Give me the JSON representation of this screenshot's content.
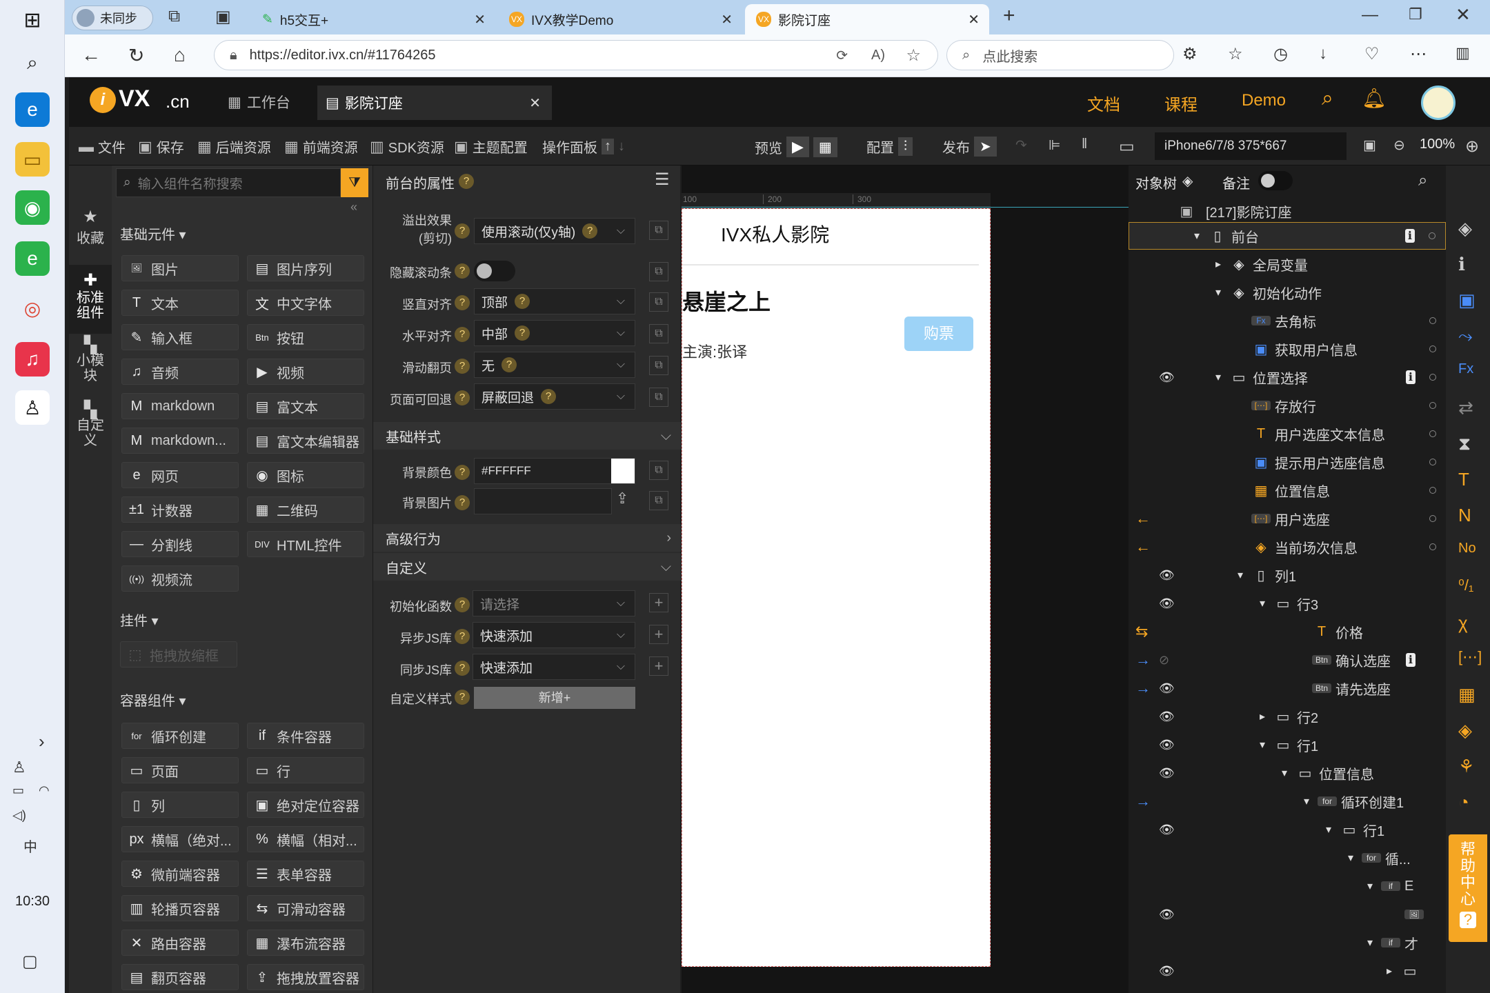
{
  "taskbar": {
    "time": "10:30"
  },
  "browser": {
    "profile": "未同步",
    "tabs": [
      {
        "label": "h5交互+"
      },
      {
        "label": "IVX教学Demo"
      },
      {
        "label": "影院订座"
      }
    ],
    "url": "https://editor.ivx.cn/#11764265",
    "search_placeholder": "点此搜索"
  },
  "app": {
    "logo": "VX",
    "logo_suffix": ".cn",
    "tabs": [
      {
        "label": "工作台"
      },
      {
        "label": "影院订座"
      }
    ],
    "nav": [
      {
        "label": "文档"
      },
      {
        "label": "课程"
      },
      {
        "label": "Demo"
      }
    ]
  },
  "toolbar": {
    "items": [
      {
        "label": "文件"
      },
      {
        "label": "保存"
      },
      {
        "label": "后端资源"
      },
      {
        "label": "前端资源"
      },
      {
        "label": "SDK资源"
      },
      {
        "label": "主题配置"
      },
      {
        "label": "操作面板"
      }
    ],
    "preview": "预览",
    "config": "配置",
    "publish": "发布",
    "device": "iPhone6/7/8 375*667",
    "zoom": "100%"
  },
  "leftside": [
    {
      "label": "收藏"
    },
    {
      "label": "标准组件"
    },
    {
      "label": "小模块"
    },
    {
      "label": "自定义"
    }
  ],
  "leftpanel": {
    "search_placeholder": "输入组件名称搜索",
    "section_basic": "基础元件",
    "basic": [
      "图片",
      "图片序列",
      "文本",
      "中文字体",
      "输入框",
      "按钮",
      "音频",
      "视频",
      "markdown",
      "富文本",
      "markdown...",
      "富文本编辑器",
      "网页",
      "图标",
      "计数器",
      "二维码",
      "分割线",
      "HTML控件",
      "视频流"
    ],
    "section_plugin": "挂件",
    "plugin": [
      "拖拽放缩框"
    ],
    "section_container": "容器组件",
    "container": [
      "循环创建",
      "条件容器",
      "页面",
      "行",
      "列",
      "绝对定位容器",
      "横幅（绝对...",
      "横幅（相对...",
      "微前端容器",
      "表单容器",
      "轮播页容器",
      "可滑动容器",
      "路由容器",
      "瀑布流容器",
      "翻页容器",
      "拖拽放置容器"
    ]
  },
  "props": {
    "title": "前台的属性",
    "rows": [
      {
        "label": "溢出效果",
        "label2": "(剪切)",
        "value": "使用滚动(仅y轴)"
      },
      {
        "label": "隐藏滚动条"
      },
      {
        "label": "竖直对齐",
        "value": "顶部"
      },
      {
        "label": "水平对齐",
        "value": "中部"
      },
      {
        "label": "滑动翻页",
        "value": "无"
      },
      {
        "label": "页面可回退",
        "value": "屏蔽回退"
      }
    ],
    "basic_style": "基础样式",
    "bg_color_label": "背景颜色",
    "bg_color": "#FFFFFF",
    "bg_image_label": "背景图片",
    "advanced": "高级行为",
    "custom": "自定义",
    "init_label": "初始化函数",
    "init_value": "请选择",
    "async_label": "异步JS库",
    "async_value": "快速添加",
    "sync_label": "同步JS库",
    "sync_value": "快速添加",
    "style_label": "自定义样式",
    "style_btn": "新增+"
  },
  "canvas": {
    "ruler": [
      "100",
      "200",
      "300"
    ],
    "title": "IVX私人影院",
    "movie": "悬崖之上",
    "actor": "主演:张译",
    "buy": "购票"
  },
  "tree": {
    "tab_label": "对象树",
    "note_label": "备注",
    "root": "[217]影院订座",
    "nodes": [
      "前台",
      "全局变量",
      "初始化动作",
      "去角标",
      "获取用户信息",
      "位置选择",
      "存放行",
      "用户选座文本信息",
      "提示用户选座信息",
      "位置信息",
      "用户选座",
      "当前场次信息",
      "列1",
      "行3",
      "价格",
      "确认选座",
      "请先选座",
      "行2",
      "行1",
      "位置信息",
      "循环创建1",
      "行1",
      "循...",
      "E",
      "",
      "才",
      ""
    ]
  },
  "help": "帮助中心",
  "colors": {
    "accent": "#f5a623",
    "blue": "#4a8cf7",
    "buy": "#9dd3f7"
  }
}
